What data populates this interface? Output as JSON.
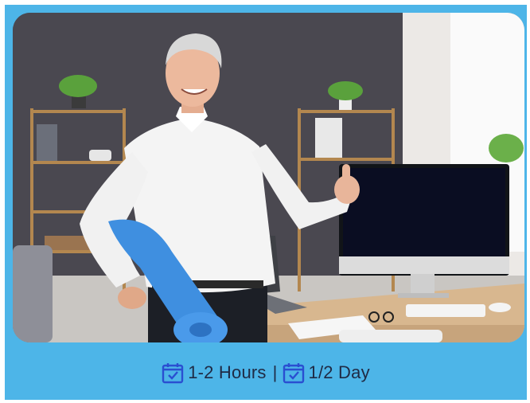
{
  "image": {
    "alt": "Smiling senior man in white shirt holding a blue yoga mat and giving a thumbs up in an office"
  },
  "duration": {
    "first": "1-2 Hours",
    "separator": "|",
    "second": "1/2 Day",
    "icon": "calendar-check-icon"
  },
  "colors": {
    "background": "#4db5e8",
    "text": "#1f2a44",
    "mat": "#3f8fe0",
    "shirt": "#f4f4f4"
  }
}
